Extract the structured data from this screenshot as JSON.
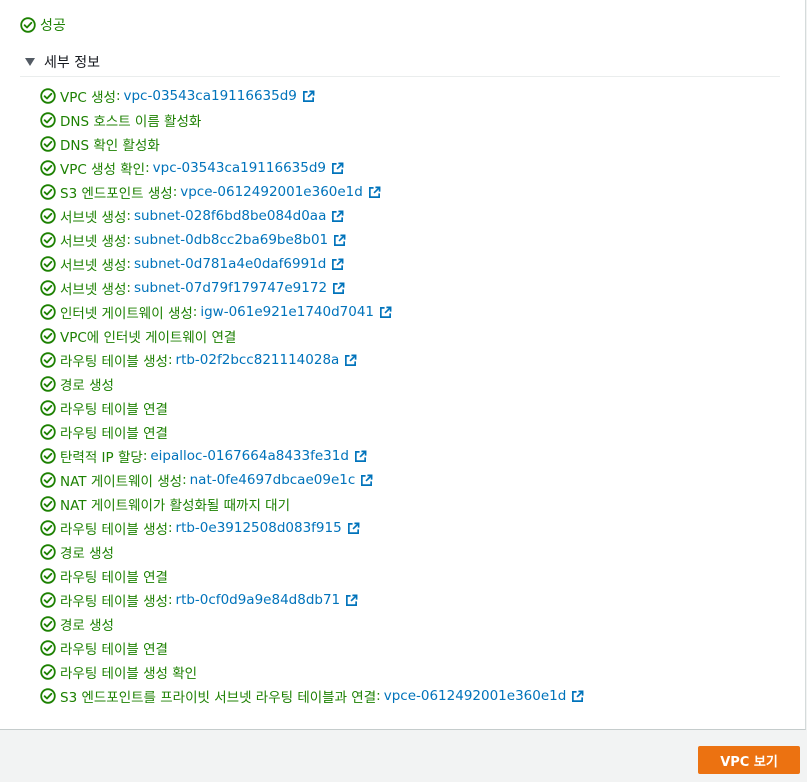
{
  "status": {
    "text": "성공",
    "icon": "check-circle-icon",
    "color": "#1d8102"
  },
  "details": {
    "title": "세부 정보",
    "expanded": true
  },
  "steps": [
    {
      "label": "VPC 생성",
      "link": "vpc-03543ca19116635d9"
    },
    {
      "label": "DNS 호스트 이름 활성화",
      "link": null
    },
    {
      "label": "DNS 확인 활성화",
      "link": null
    },
    {
      "label": "VPC 생성 확인",
      "link": "vpc-03543ca19116635d9"
    },
    {
      "label": "S3 엔드포인트 생성",
      "link": "vpce-0612492001e360e1d"
    },
    {
      "label": "서브넷 생성",
      "link": "subnet-028f6bd8be084d0aa"
    },
    {
      "label": "서브넷 생성",
      "link": "subnet-0db8cc2ba69be8b01"
    },
    {
      "label": "서브넷 생성",
      "link": "subnet-0d781a4e0daf6991d"
    },
    {
      "label": "서브넷 생성",
      "link": "subnet-07d79f179747e9172"
    },
    {
      "label": "인터넷 게이트웨이 생성",
      "link": "igw-061e921e1740d7041"
    },
    {
      "label": "VPC에 인터넷 게이트웨이 연결",
      "link": null
    },
    {
      "label": "라우팅 테이블 생성",
      "link": "rtb-02f2bcc821114028a"
    },
    {
      "label": "경로 생성",
      "link": null
    },
    {
      "label": "라우팅 테이블 연결",
      "link": null
    },
    {
      "label": "라우팅 테이블 연결",
      "link": null
    },
    {
      "label": "탄력적 IP 할당",
      "link": "eipalloc-0167664a8433fe31d"
    },
    {
      "label": "NAT 게이트웨이 생성",
      "link": "nat-0fe4697dbcae09e1c"
    },
    {
      "label": "NAT 게이트웨이가 활성화될 때까지 대기",
      "link": null
    },
    {
      "label": "라우팅 테이블 생성",
      "link": "rtb-0e3912508d083f915"
    },
    {
      "label": "경로 생성",
      "link": null
    },
    {
      "label": "라우팅 테이블 연결",
      "link": null
    },
    {
      "label": "라우팅 테이블 생성",
      "link": "rtb-0cf0d9a9e84d8db71"
    },
    {
      "label": "경로 생성",
      "link": null
    },
    {
      "label": "라우팅 테이블 연결",
      "link": null
    },
    {
      "label": "라우팅 테이블 생성 확인",
      "link": null
    },
    {
      "label": "S3 엔드포인트를 프라이빗 서브넷 라우팅 테이블과 연결",
      "link": "vpce-0612492001e360e1d"
    }
  ],
  "separator": ":",
  "link_icon": "external-link-icon",
  "colors": {
    "success": "#1d8102",
    "link": "#0073bb",
    "primary_button": "#ec7211"
  },
  "footer": {
    "view_vpc_label": "VPC 보기"
  }
}
